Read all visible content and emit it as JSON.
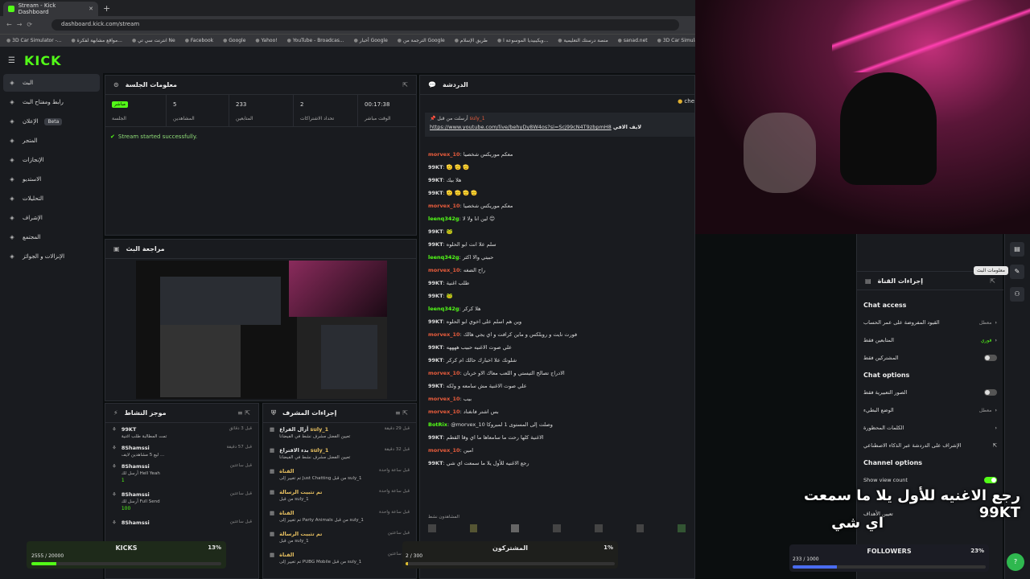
{
  "browser": {
    "tab_title": "Stream - Kick Dashboard",
    "url": "dashboard.kick.com/stream",
    "bookmarks": [
      "3D Car Simulator -...",
      "مواقع مشابهة لفكرة...",
      "انترنت سي تي Ne",
      "Facebook",
      "Google",
      "Yahoo!",
      "YouTube - Broadcas...",
      "أخبار Google",
      "الترجمة من Google",
      "طريق الإسلام",
      "ويكيبيديا الموسوعة ا...",
      "منصة درستك التعليمية",
      "sanad.net",
      "3D Car Simulator"
    ]
  },
  "brand": {
    "logo": "KICK",
    "accent": "#53fc18"
  },
  "sidebar": {
    "items": [
      {
        "label": "البث",
        "icon": "broadcast-icon"
      },
      {
        "label": "رابط ومفتاح البث",
        "icon": "key-icon"
      },
      {
        "label": "الإعلان",
        "icon": "ad-icon",
        "badge": "Beta"
      },
      {
        "label": "المتجر",
        "icon": "store-icon"
      },
      {
        "label": "الإنجازات",
        "icon": "trophy-icon"
      },
      {
        "label": "الاستديو",
        "icon": "studio-icon"
      },
      {
        "label": "التحليلات",
        "icon": "analytics-icon"
      },
      {
        "label": "الإشراف",
        "icon": "moderation-icon"
      },
      {
        "label": "المجتمع",
        "icon": "community-icon"
      },
      {
        "label": "الإنزالات و الجوائز",
        "icon": "drops-icon"
      }
    ]
  },
  "session": {
    "title": "معلومات الجلسة",
    "live_badge": "مباشر",
    "stats": [
      {
        "label": "الجلسة",
        "value": ""
      },
      {
        "label": "المشاهدين",
        "value": "5"
      },
      {
        "label": "المتابعين",
        "value": "233"
      },
      {
        "label": "تحداد الاشتراكات",
        "value": "2"
      },
      {
        "label": "الوقت مباشر",
        "value": "00:17:38"
      }
    ],
    "status": "Stream started successfully."
  },
  "preview": {
    "title": "مراجعة البث"
  },
  "activity": {
    "title": "موجز النشاط",
    "items": [
      {
        "user": "99KT",
        "detail": "تمت المطالبة طلب اغنية",
        "time": "قبل 3 دقائق"
      },
      {
        "user": "8Shamssi",
        "detail": "ليع 5 مشاهدين لايف ...",
        "time": "قبل 57 دقيقة"
      },
      {
        "user": "8Shamssi",
        "detail": "أرسل لك Hell Yeah",
        "time": "قبل ساعتين"
      },
      {
        "user": "8Shamssi",
        "detail": "أرسل لك Full Send",
        "time": "قبل ساعتين"
      },
      {
        "user": "8Shamssi",
        "detail": "",
        "time": "قبل ساعتين"
      }
    ],
    "kicks": [
      "1",
      "100"
    ]
  },
  "modactions": {
    "title": "إجراءات المشرف",
    "items": [
      {
        "user": "suly_1",
        "action": "أزال القراع",
        "detail": "تعيين الفضل مشرف نشط في الفيضانا",
        "time": "قبل 29 دقيقة"
      },
      {
        "user": "suly_1",
        "action": "بدء الاقتراع",
        "detail": "تعيين الفضل مشرف نشط في الفيضانا",
        "time": "قبل 32 دقيقة"
      },
      {
        "user": "القناة",
        "action": "",
        "detail": "تم تغيير إلى Just Chatting من قبل suly_1",
        "time": "قبل ساعة واحدة"
      },
      {
        "user": "تم تثبيت الرسالة",
        "action": "",
        "detail": "من قبل suly_1",
        "time": "قبل ساعة واحدة"
      },
      {
        "user": "القناة",
        "action": "",
        "detail": "تم تغيير إلى Party Animals من قبل suly_1",
        "time": "قبل ساعة واحدة"
      },
      {
        "user": "تم تثبيت الرسالة",
        "action": "",
        "detail": "من قبل suly_1",
        "time": "قبل ساعتين"
      },
      {
        "user": "القناة",
        "action": "",
        "detail": "تم تغيير إلى PUBG Mobile من قبل suly_1",
        "time": "قبل ساعتين"
      }
    ]
  },
  "chat": {
    "title": "الدردشة",
    "pinned": {
      "by": "suly_1",
      "label": "أرسلت من قبل",
      "title": "لايف الاقي",
      "link": "https://www.youtube.com/live/behyDy8W4os?si=Scj99cN4T9zbpmH8"
    },
    "messages": [
      {
        "user": "morvex_10",
        "color": "#e85c3c",
        "text": "معكم موريكس شخصيا"
      },
      {
        "user": "99KT",
        "color": "#dddddd",
        "text": "🫡 🫡 🫡"
      },
      {
        "user": "99KT",
        "color": "#dddddd",
        "text": "هلا بيك"
      },
      {
        "user": "99KT",
        "color": "#dddddd",
        "text": "🫡 🫡 🫡 🫡"
      },
      {
        "user": "morvex_10",
        "color": "#e85c3c",
        "text": "معكم موريكس شخصيا"
      },
      {
        "user": "leenq342g",
        "color": "#53fc18",
        "text": "لين انا ولا لا 😊"
      },
      {
        "user": "99KT",
        "color": "#dddddd",
        "text": "🐸"
      },
      {
        "user": "99KT",
        "color": "#dddddd",
        "text": "سلم علا انت ابو الحلوه"
      },
      {
        "user": "leenq342g",
        "color": "#53fc18",
        "text": "حبيتي والا اكثر"
      },
      {
        "user": "morvex_10",
        "color": "#e85c3c",
        "text": "راح الضغه"
      },
      {
        "user": "99KT",
        "color": "#dddddd",
        "text": "طلب اغنية"
      },
      {
        "user": "99KT",
        "color": "#dddddd",
        "text": "🐸"
      },
      {
        "user": "leenq342g",
        "color": "#53fc18",
        "text": "هلا كركر"
      },
      {
        "user": "99KT",
        "color": "#dddddd",
        "text": "وين هم اسلم على اخوي ابو الحلوه"
      },
      {
        "user": "morvex_10",
        "color": "#e85c3c",
        "text": "فورت نايت و روبلكس و ماين كرافت و اي يجي هالك"
      },
      {
        "user": "99KT",
        "color": "#dddddd",
        "text": "علي صوت الاغنيه حبيب ههههه"
      },
      {
        "user": "99KT",
        "color": "#dddddd",
        "text": "شلونك علا اخبارك حالك ام كركر"
      },
      {
        "user": "morvex_10",
        "color": "#e85c3c",
        "text": "الادراج تصالح التيستي و اللعب معاك الاو خربان"
      },
      {
        "user": "99KT",
        "color": "#dddddd",
        "text": "علي صوت الاغنية مش سامعه و ولكه"
      },
      {
        "user": "morvex_10",
        "color": "#e85c3c",
        "text": "بيب"
      },
      {
        "user": "morvex_10",
        "color": "#e85c3c",
        "text": "بس اشتر فانغناد"
      },
      {
        "user": "BotRix",
        "color": "#53fc18",
        "text": "@morvex_10 وصلت إلى المستوى 1 لمبروكا"
      },
      {
        "user": "99KT",
        "color": "#dddddd",
        "text": "الاغنية كلها رحت ما سامعاها ما اي وقا القطم"
      },
      {
        "user": "morvex_10",
        "color": "#e85c3c",
        "text": "امين"
      },
      {
        "user": "99KT",
        "color": "#dddddd",
        "text": "رجع الاغنيه للأول يلا ما سمعت اي شي"
      }
    ],
    "cheer_label": "che",
    "viewers_label": "المشاهدون نشط"
  },
  "chat_settings": {
    "title": "إجراءات القناة",
    "access_header": "Chat access",
    "access": [
      {
        "label": "القيود المفروضة على عمر الحساب",
        "value": "معطل",
        "type": "link"
      },
      {
        "label": "المتابعين فقط",
        "value": "فوري",
        "type": "link"
      },
      {
        "label": "المشتركين فقط",
        "value": "",
        "type": "toggle",
        "on": false
      }
    ],
    "options_header": "Chat options",
    "options": [
      {
        "label": "الصور التعبيرية فقط",
        "value": "",
        "type": "toggle",
        "on": false
      },
      {
        "label": "الوضع البطيء",
        "value": "معطل",
        "type": "link"
      },
      {
        "label": "الكلمات المحظورة",
        "value": "",
        "type": "link"
      },
      {
        "label": "الإشراف على الدردشة عبر الذكاء الاصطناعي",
        "value": "",
        "type": "ext"
      }
    ],
    "channel_header": "Channel options",
    "channel": [
      {
        "label": "Show view count",
        "type": "toggle",
        "on": true
      }
    ],
    "tooltip": "معلومات البث",
    "bottom_item": "تعيين الأهداف",
    "bottom_count": "عمل 2"
  },
  "overlays": {
    "caption_line1": "رجع الاغنيه للأول يلا ما سمعت  99KT",
    "caption_line2": "اي شي",
    "kicks_goal": {
      "label": "KICKS",
      "percent_text": "13%",
      "progress": "2555 / 20000",
      "fraction": 0.13
    },
    "subs_goal": {
      "label": "المشتركون",
      "percent_text": "1%",
      "progress": "2 / 300",
      "fraction": 0.01
    },
    "followers_goal": {
      "label": "FOLLOWERS",
      "percent_text": "23%",
      "progress": "233 / 1000",
      "fraction": 0.23
    }
  }
}
